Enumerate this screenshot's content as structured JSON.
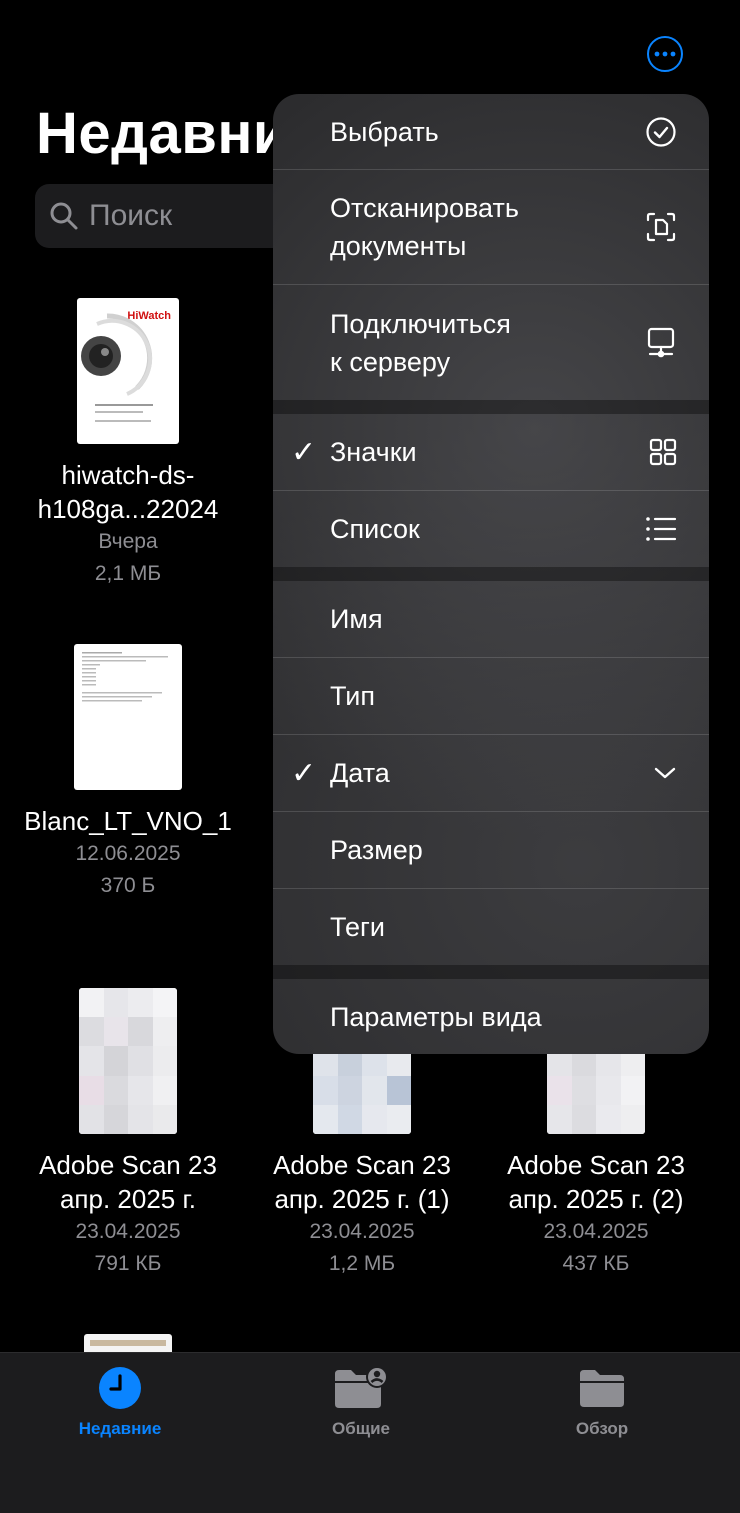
{
  "header": {
    "title": "Недавние"
  },
  "search": {
    "placeholder": "Поиск"
  },
  "files": [
    {
      "name_line1": "hiwatch-ds-",
      "name_line2": "h108ga...22024",
      "date": "Вчера",
      "size": "2,1 МБ",
      "thumb_brand": "HiWatch"
    },
    {
      "name_line1": "Blanc_LT_VNO_1",
      "name_line2": "",
      "date": "12.06.2025",
      "size": "370 Б"
    },
    {
      "name_line1": "Adobe Scan 23",
      "name_line2": "апр. 2025 г.",
      "date": "23.04.2025",
      "size": "791 КБ"
    },
    {
      "name_line1": "Adobe Scan 23",
      "name_line2": "апр. 2025 г. (1)",
      "date": "23.04.2025",
      "size": "1,2 МБ"
    },
    {
      "name_line1": "Adobe Scan 23",
      "name_line2": "апр. 2025 г. (2)",
      "date": "23.04.2025",
      "size": "437 КБ"
    }
  ],
  "menu": {
    "select": "Выбрать",
    "scan_line1": "Отсканировать",
    "scan_line2": "документы",
    "connect_line1": "Подключиться",
    "connect_line2": "к серверу",
    "icons": "Значки",
    "list": "Список",
    "sort_name": "Имя",
    "sort_type": "Тип",
    "sort_date": "Дата",
    "sort_size": "Размер",
    "sort_tags": "Теги",
    "view_options": "Параметры вида",
    "checkmark": "✓"
  },
  "tabs": [
    {
      "label": "Недавние",
      "icon": "clock-icon"
    },
    {
      "label": "Общие",
      "icon": "shared-folder-icon"
    },
    {
      "label": "Обзор",
      "icon": "folder-icon"
    }
  ],
  "colors": {
    "accent": "#0a84ff",
    "secondary_text": "#8e8e93",
    "menu_bg": "#2c2c2e"
  }
}
